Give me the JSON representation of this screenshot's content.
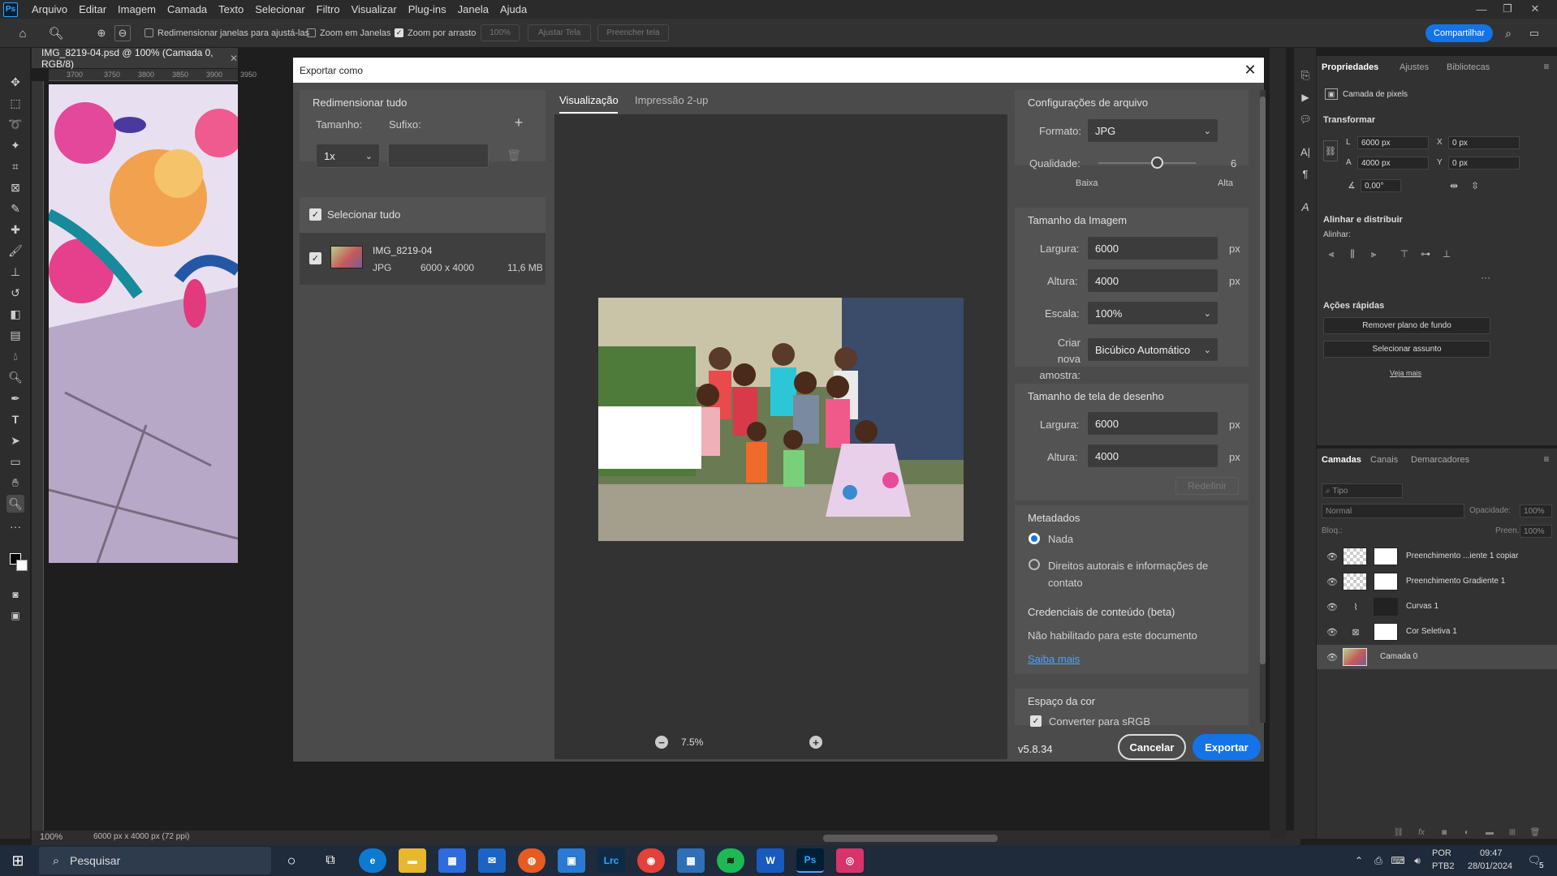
{
  "menu": {
    "items": [
      "Arquivo",
      "Editar",
      "Imagem",
      "Camada",
      "Texto",
      "Selecionar",
      "Filtro",
      "Visualizar",
      "Plug-ins",
      "Janela",
      "Ajuda"
    ]
  },
  "optbar": {
    "resize_windows": "Redimensionar janelas para ajustá-las",
    "zoom_all": "Zoom em Janelas",
    "scrubby_zoom": "Zoom por arrasto",
    "zoom_pct": "100%",
    "fit_screen": "Ajustar Tela",
    "fill_screen": "Preencher tela",
    "share": "Compartilhar"
  },
  "document": {
    "tab_title": "IMG_8219-04.psd @ 100% (Camada 0, RGB/8)",
    "ruler": [
      "3700",
      "3750",
      "3800",
      "3850",
      "3900",
      "3950"
    ],
    "zoom": "100%",
    "size_info": "6000 px x 4000 px (72 ppi)"
  },
  "dialog": {
    "title": "Exportar como",
    "resize": {
      "heading": "Redimensionar tudo",
      "size_label": "Tamanho:",
      "suffix_label": "Sufixo:",
      "scale": "1x"
    },
    "select_all": "Selecionar tudo",
    "asset": {
      "name": "IMG_8219-04",
      "format": "JPG",
      "dims": "6000 x 4000",
      "filesize": "11,6 MB"
    },
    "tabs": {
      "preview": "Visualização",
      "twoup": "Impressão 2-up"
    },
    "zoom": "7.5%",
    "version": "v5.8.34",
    "file": {
      "heading": "Configurações de arquivo",
      "format_label": "Formato:",
      "format": "JPG",
      "quality_label": "Qualidade:",
      "quality": "6",
      "quality_fraction": 0.6,
      "low": "Baixa",
      "high": "Alta"
    },
    "image_size": {
      "heading": "Tamanho da Imagem",
      "width_label": "Largura:",
      "width": "6000",
      "height_label": "Altura:",
      "height": "4000",
      "unit": "px",
      "scale_label": "Escala:",
      "scale": "100%",
      "resample_label": "Criar nova amostra:",
      "resample": "Bicúbico Automático"
    },
    "canvas_size": {
      "heading": "Tamanho de tela de desenho",
      "width_label": "Largura:",
      "width": "6000",
      "height_label": "Altura:",
      "height": "4000",
      "unit": "px",
      "reset": "Redefinir"
    },
    "metadata": {
      "heading": "Metadados",
      "none": "Nada",
      "copyright": "Direitos autorais e informações de contato"
    },
    "credentials": {
      "heading": "Credenciais de conteúdo (beta)",
      "status": "Não habilitado para este documento",
      "learn": "Saiba mais"
    },
    "color": {
      "heading": "Espaço da cor",
      "convert": "Converter para sRGB"
    },
    "cancel": "Cancelar",
    "export": "Exportar"
  },
  "properties": {
    "tabs": [
      "Propriedades",
      "Ajustes",
      "Bibliotecas"
    ],
    "layer_type": "Camada de pixels",
    "transform": {
      "heading": "Transformar",
      "w_label": "L",
      "w": "6000 px",
      "h_label": "A",
      "h": "4000 px",
      "x_label": "X",
      "x": "0 px",
      "y_label": "Y",
      "y": "0 px",
      "angle": "0,00°"
    },
    "align": {
      "heading": "Alinhar e distribuir",
      "label": "Alinhar:"
    },
    "quick": {
      "heading": "Ações rápidas",
      "remove_bg": "Remover plano de fundo",
      "select_subject": "Selecionar assunto",
      "more": "Veja mais"
    }
  },
  "layers": {
    "tabs": [
      "Camadas",
      "Canais",
      "Demarcadores"
    ],
    "search": "Tipo",
    "blend": "Normal",
    "opacity_label": "Opacidade:",
    "opacity": "100%",
    "lock_label": "Bloq.:",
    "fill_label": "Preen.:",
    "fill": "100%",
    "items": [
      "Preenchimento ...iente 1 copiar",
      "Preenchimento Gradiente 1",
      "Curvas 1",
      "Cor Seletiva 1",
      "Camada 0"
    ]
  },
  "taskbar": {
    "search": "Pesquisar",
    "lang1": "POR",
    "lang2": "PTB2",
    "time": "09:47",
    "date": "28/01/2024",
    "notif": "5"
  }
}
